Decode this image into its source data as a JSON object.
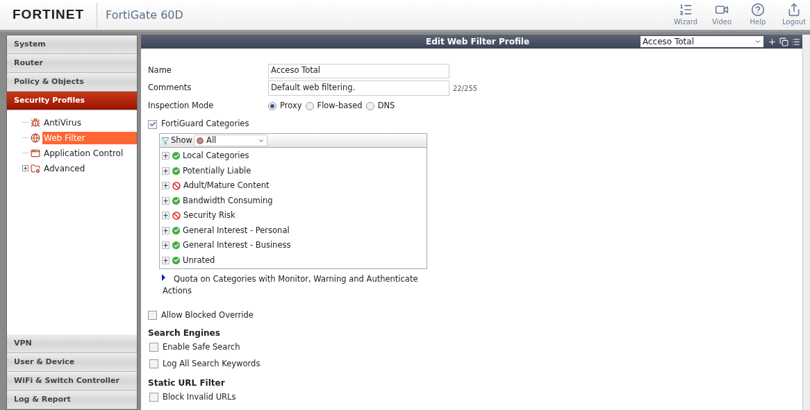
{
  "header": {
    "logo": "FORTINET",
    "device": "FortiGate 60D",
    "actions": [
      {
        "kind": "wizard",
        "label": "Wizard"
      },
      {
        "kind": "video",
        "label": "Video"
      },
      {
        "kind": "help",
        "label": "Help"
      },
      {
        "kind": "logout",
        "label": "Logout"
      }
    ]
  },
  "sidebar": {
    "top_sections": [
      {
        "label": "System",
        "selected": false
      },
      {
        "label": "Router",
        "selected": false
      },
      {
        "label": "Policy & Objects",
        "selected": false
      },
      {
        "label": "Security Profiles",
        "selected": true
      }
    ],
    "tree": [
      {
        "kind": "antivirus",
        "label": "AntiVirus",
        "selected": false
      },
      {
        "kind": "webfilter",
        "label": "Web Filter",
        "selected": true
      },
      {
        "kind": "appcontrol",
        "label": "Application Control",
        "selected": false
      },
      {
        "kind": "advanced",
        "label": "Advanced",
        "selected": false,
        "expanded": false
      }
    ],
    "bottom_sections": [
      {
        "label": "VPN",
        "selected": false
      },
      {
        "label": "User & Device",
        "selected": false
      },
      {
        "label": "WiFi & Switch Controller",
        "selected": false
      },
      {
        "label": "Log & Report",
        "selected": false
      }
    ]
  },
  "panel": {
    "title": "Edit Web Filter Profile",
    "profile_select": "Acceso Total",
    "form": {
      "name_label": "Name",
      "name_value": "Acceso Total",
      "comments_label": "Comments",
      "comments_value": "Default web filtering.",
      "comments_count": "22/255",
      "mode_label": "Inspection Mode",
      "modes": [
        {
          "label": "Proxy",
          "selected": true
        },
        {
          "label": "Flow-based",
          "selected": false
        },
        {
          "label": "DNS",
          "selected": false
        }
      ]
    },
    "fortiguard": {
      "label": "FortiGuard Categories",
      "checked": true,
      "show_label": "Show",
      "show_value": "All",
      "categories": [
        {
          "label": "Local Categories",
          "kind": "allow"
        },
        {
          "label": "Potentially Liable",
          "kind": "allow"
        },
        {
          "label": "Adult/Mature Content",
          "kind": "block"
        },
        {
          "label": "Bandwidth Consuming",
          "kind": "allow"
        },
        {
          "label": "Security Risk",
          "kind": "block"
        },
        {
          "label": "General Interest - Personal",
          "kind": "allow"
        },
        {
          "label": "General Interest - Business",
          "kind": "allow"
        },
        {
          "label": "Unrated",
          "kind": "allow"
        }
      ],
      "quota": {
        "label": "Quota on Categories with Monitor, Warning and Authenticate Actions",
        "expanded": false
      }
    },
    "allow_blocked_override": {
      "label": "Allow Blocked Override",
      "checked": false
    },
    "sections": [
      {
        "title": "Search Engines",
        "options": [
          {
            "label": "Enable Safe Search",
            "checked": false
          },
          {
            "label": "Log All Search Keywords",
            "checked": false
          }
        ]
      },
      {
        "title": "Static URL Filter",
        "options": [
          {
            "label": "Block Invalid URLs",
            "checked": false
          }
        ]
      }
    ]
  }
}
